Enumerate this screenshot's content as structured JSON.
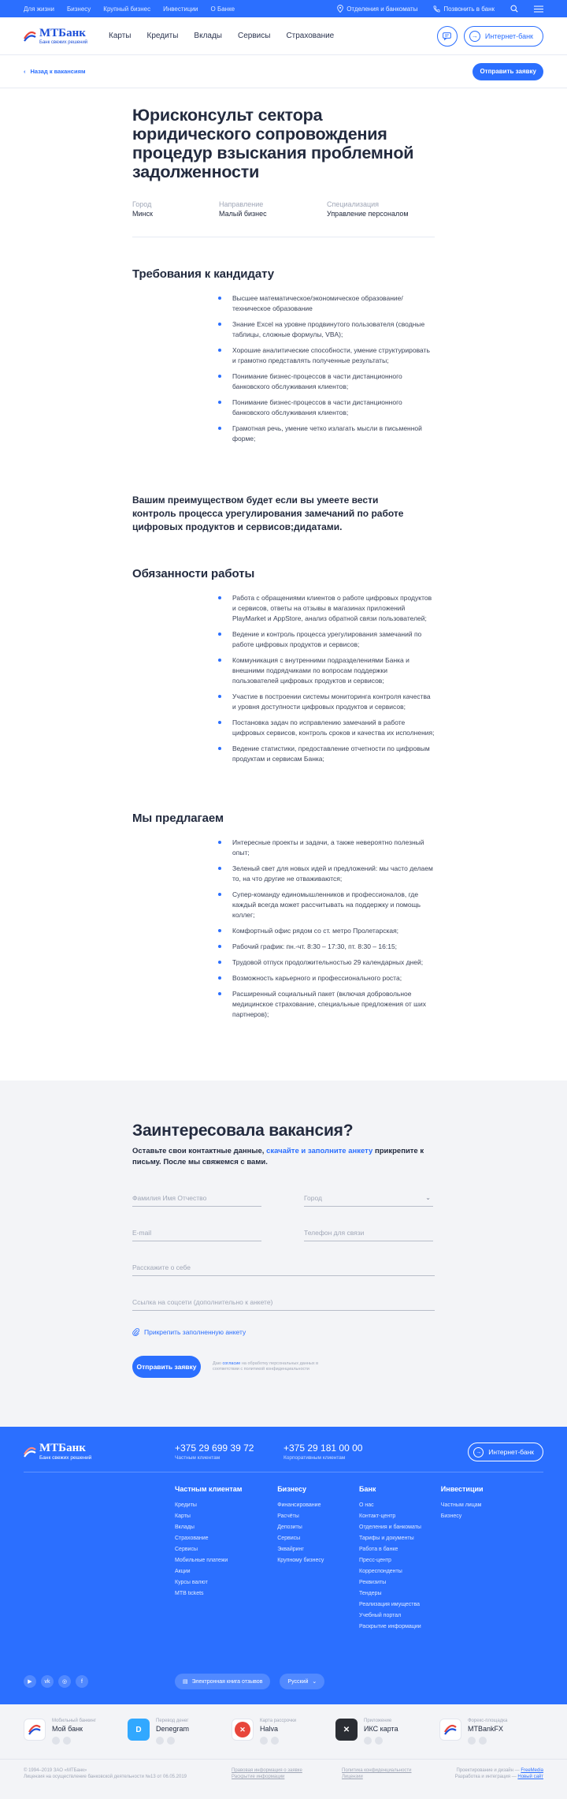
{
  "topbar": {
    "segments": [
      "Для жизни",
      "Бизнесу",
      "Крупный бизнес",
      "Инвестиции",
      "О Банке"
    ],
    "branches": "Отделения и банкоматы",
    "call": "Позвонить в банк"
  },
  "header": {
    "logo_word": "МТБанк",
    "logo_slogan": "Банк свежих решений",
    "nav": [
      "Карты",
      "Кредиты",
      "Вклады",
      "Сервисы",
      "Страхование"
    ],
    "internet_bank": "Интернет-банк"
  },
  "subbar": {
    "back": "Назад к вакансиям",
    "send": "Отправить заявку"
  },
  "vacancy": {
    "title": "Юрисконсульт сектора юридического сопровождения процедур взыскания проблемной задолженности",
    "meta": [
      {
        "label": "Город",
        "value": "Минск"
      },
      {
        "label": "Направление",
        "value": "Малый бизнес"
      },
      {
        "label": "Специализация",
        "value": "Управление персоналом"
      }
    ]
  },
  "requirements": {
    "title": "Требования к кандидату",
    "items": [
      "Высшее математическое/экономическое образование/техническое образование",
      "Знание Excel на уровне продвинутого пользователя (сводные таблицы, сложные формулы, VBA);",
      "Хорошие аналитические способности, умение структурировать и грамотно представлять полученные результаты;",
      "Понимание бизнес-процессов в части дистанционного банковского обслуживания клиентов;",
      "Понимание бизнес-процессов в части дистанционного банковского обслуживания клиентов;",
      "Грамотная речь, умение четко излагать мысли в письменной форме;"
    ]
  },
  "advantage": "Вашим преимуществом будет если вы умеете вести контроль процесса урегулирования замечаний по работе цифровых продуктов и сервисов;дидатами.",
  "duties": {
    "title": "Обязанности работы",
    "items": [
      "Работа с обращениями клиентов о работе цифровых продуктов и сервисов, ответы на отзывы в магазинах приложений PlayMarket и AppStore, анализ обратной связи пользователей;",
      "Ведение и контроль процесса урегулирования замечаний по работе цифровых продуктов и сервисов;",
      "Коммуникация с внутренними подразделениями Банка и внешними подрядчиками по вопросам поддержки пользователей цифровых продуктов и сервисов;",
      "Участие в построении системы мониторинга контроля качества и уровня доступности цифровых продуктов и сервисов;",
      "Постановка задач по исправлению замечаний в работе цифровых сервисов, контроль сроков и качества их исполнения;",
      "Ведение статистики, предоставление отчетности по цифровым продуктам и сервисам Банка;"
    ]
  },
  "offer": {
    "title": "Мы предлагаем",
    "items": [
      "Интересные проекты и задачи, а также невероятно полезный опыт;",
      "Зеленый свет для новых идей и предложений: мы часто делаем то, на что другие не отваживаются;",
      "Супер-команду единомышленников и профессионалов, где каждый всегда может рассчитывать на поддержку и помощь коллег;",
      "Комфортный офис рядом со ст. метро Пролетарская;",
      "Рабочий график: пн.-чт. 8:30 – 17:30, пт. 8:30 – 16:15;",
      "Трудовой отпуск продолжительностью 29 календарных дней;",
      "Возможность карьерного и профессионального роста;",
      "Расширенный социальный пакет (включая добровольное медицинское страхование, специальные предложения от ших партнеров);"
    ]
  },
  "form": {
    "title": "Заинтересовала вакансия?",
    "sub_before": "Оставьте свои контактные данные, ",
    "sub_link": "скачайте и заполните анкету",
    "sub_after": " прикрепите к письму. После мы  свяжемся с вами.",
    "fio": "Фамилия Имя Отчество",
    "city": "Город",
    "email": "E-mail",
    "phone": "Телефон для связи",
    "about": "Расскажите о себе",
    "link": "Ссылка на соцсети (дополнительно к анкете)",
    "attach": "Прикрепить заполненную анкету",
    "send": "Отправить заявку",
    "consent_before": "Даю ",
    "consent_link": "согласие",
    "consent_after": " на обработку персональных данных в соответствии с политикой конфиденциальности"
  },
  "footer": {
    "logo_word": "МТБанк",
    "logo_slogan": "Банк свежих решений",
    "phones": [
      {
        "number": "+375 29 699 39 72",
        "caption": "Частным клиентам"
      },
      {
        "number": "+375 29 181 00 00",
        "caption": "Корпоративным клиентам"
      }
    ],
    "internet_bank": "Интернет-банк",
    "columns": [
      {
        "title": "Частным клиентам",
        "items": [
          "Кредиты",
          "Карты",
          "Вклады",
          "Страхование",
          "Сервисы",
          "Мобильные платежи",
          "Акции",
          "Курсы валют",
          "MTB tickets"
        ]
      },
      {
        "title": "Бизнесу",
        "items": [
          "Финансирование",
          "Расчёты",
          "Депозиты",
          "Сервисы",
          "Эквайринг",
          "Крупному бизнесу"
        ]
      },
      {
        "title": "Банк",
        "items": [
          "О нас",
          "Контакт-центр",
          "Отделения и банкоматы",
          "Тарифы и документы",
          "Работа в банке",
          "Пресс-центр",
          "Корреспонденты",
          "Реквизиты",
          "Тендеры",
          "Реализация имущества",
          "Учебный портал",
          "Раскрытие информации"
        ]
      },
      {
        "title": "Инвестиции",
        "items": [
          "Частным лицам",
          "Бизнесу"
        ]
      }
    ],
    "socials": [
      "youtube-icon",
      "vk-icon",
      "instagram-icon",
      "facebook-icon"
    ],
    "guestbook": "Электронная книга отзывов",
    "language": "Русский"
  },
  "apps": [
    {
      "caption": "Мобильный банкинг",
      "name": "Мой банк",
      "color": "#ffffff"
    },
    {
      "caption": "Перевод денег",
      "name": "Denegram",
      "color": "#31a8ff"
    },
    {
      "caption": "Карта рассрочки",
      "name": "Halva",
      "color": "#e8463b"
    },
    {
      "caption": "Приложение",
      "name": "ИКС карта",
      "color": "#2a2d33"
    },
    {
      "caption": "Форекс-площадка",
      "name": "MTBankFX",
      "color": "#ffffff"
    }
  ],
  "copyright": {
    "line1": "© 1994–2019 ЗАО «МТБанк»",
    "line2": "Лицензия на осуществление банковской деятельности №13 от 06.05.2019",
    "c2a": "Правовая информация о заявке",
    "c2b": "Раскрытие информации",
    "c3a": "Политика конфиденциальности",
    "c3b": "Лицензии",
    "c4a_text": "Проектирование и дизайн — ",
    "c4a_link": "FreeMedia",
    "c4b_text": "Разработка и интеграция — ",
    "c4b_link": "Новый сайт"
  }
}
